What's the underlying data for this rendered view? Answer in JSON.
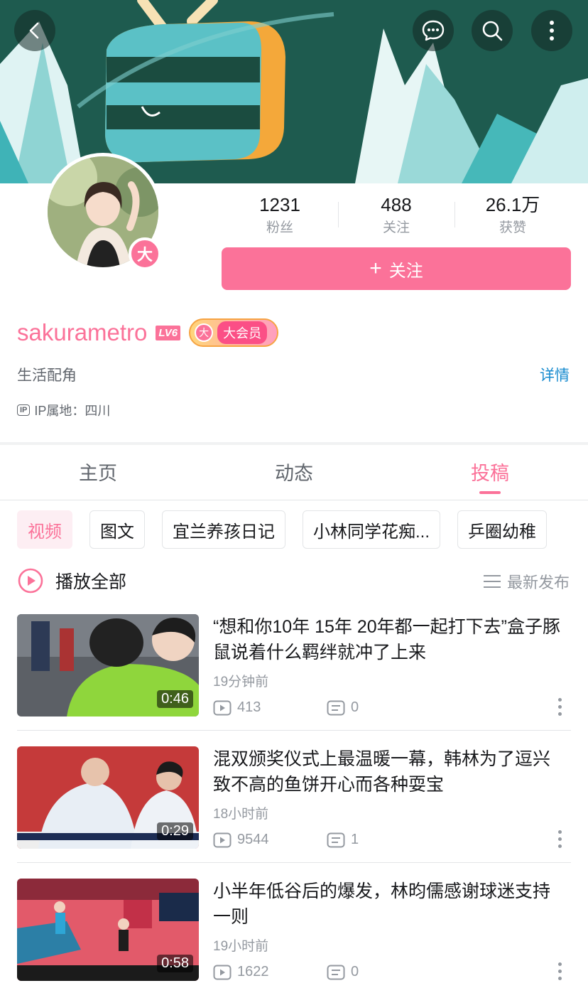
{
  "header": {
    "back_icon": "back-arrow-icon",
    "actions": [
      "message-icon",
      "search-icon",
      "more-vertical-icon"
    ]
  },
  "profile": {
    "username": "sakurametro",
    "level": "LV6",
    "vip_badge": "大",
    "vip_label": "大会员",
    "vip_icon_text": "大",
    "sign": "生活配角",
    "detail_link": "详情",
    "ip_icon": "IP",
    "ip_location": "IP属地：四川",
    "stats": [
      {
        "value": "1231",
        "label": "粉丝"
      },
      {
        "value": "488",
        "label": "关注"
      },
      {
        "value": "26.1万",
        "label": "获赞"
      }
    ],
    "follow_plus": "+",
    "follow_label": "关注"
  },
  "tabs": [
    {
      "label": "主页",
      "active": false
    },
    {
      "label": "动态",
      "active": false
    },
    {
      "label": "投稿",
      "active": true
    }
  ],
  "chips": [
    {
      "label": "视频",
      "active": true
    },
    {
      "label": "图文",
      "active": false
    },
    {
      "label": "宜兰养孩日记",
      "active": false
    },
    {
      "label": "小林同学花痴...",
      "active": false
    },
    {
      "label": "乒圈幼稚",
      "active": false
    }
  ],
  "list_header": {
    "play_all": "播放全部",
    "sort_label": "最新发布"
  },
  "videos": [
    {
      "title": "“想和你10年 15年 20年都一起打下去”盒子豚鼠说着什么羁绊就冲了上来",
      "time": "19分钟前",
      "plays": "413",
      "comments": "0",
      "duration": "0:46"
    },
    {
      "title": "混双颁奖仪式上最温暖一幕，韩林为了逗兴致不高的鱼饼开心而各种耍宝",
      "time": "18小时前",
      "plays": "9544",
      "comments": "1",
      "duration": "0:29"
    },
    {
      "title": "小半年低谷后的爆发，林昀儒感谢球迷支持一则",
      "time": "19小时前",
      "plays": "1622",
      "comments": "0",
      "duration": "0:58"
    }
  ],
  "colors": {
    "accent": "#fb7299",
    "link": "#178bcf",
    "banner": "#1f5a4e"
  }
}
